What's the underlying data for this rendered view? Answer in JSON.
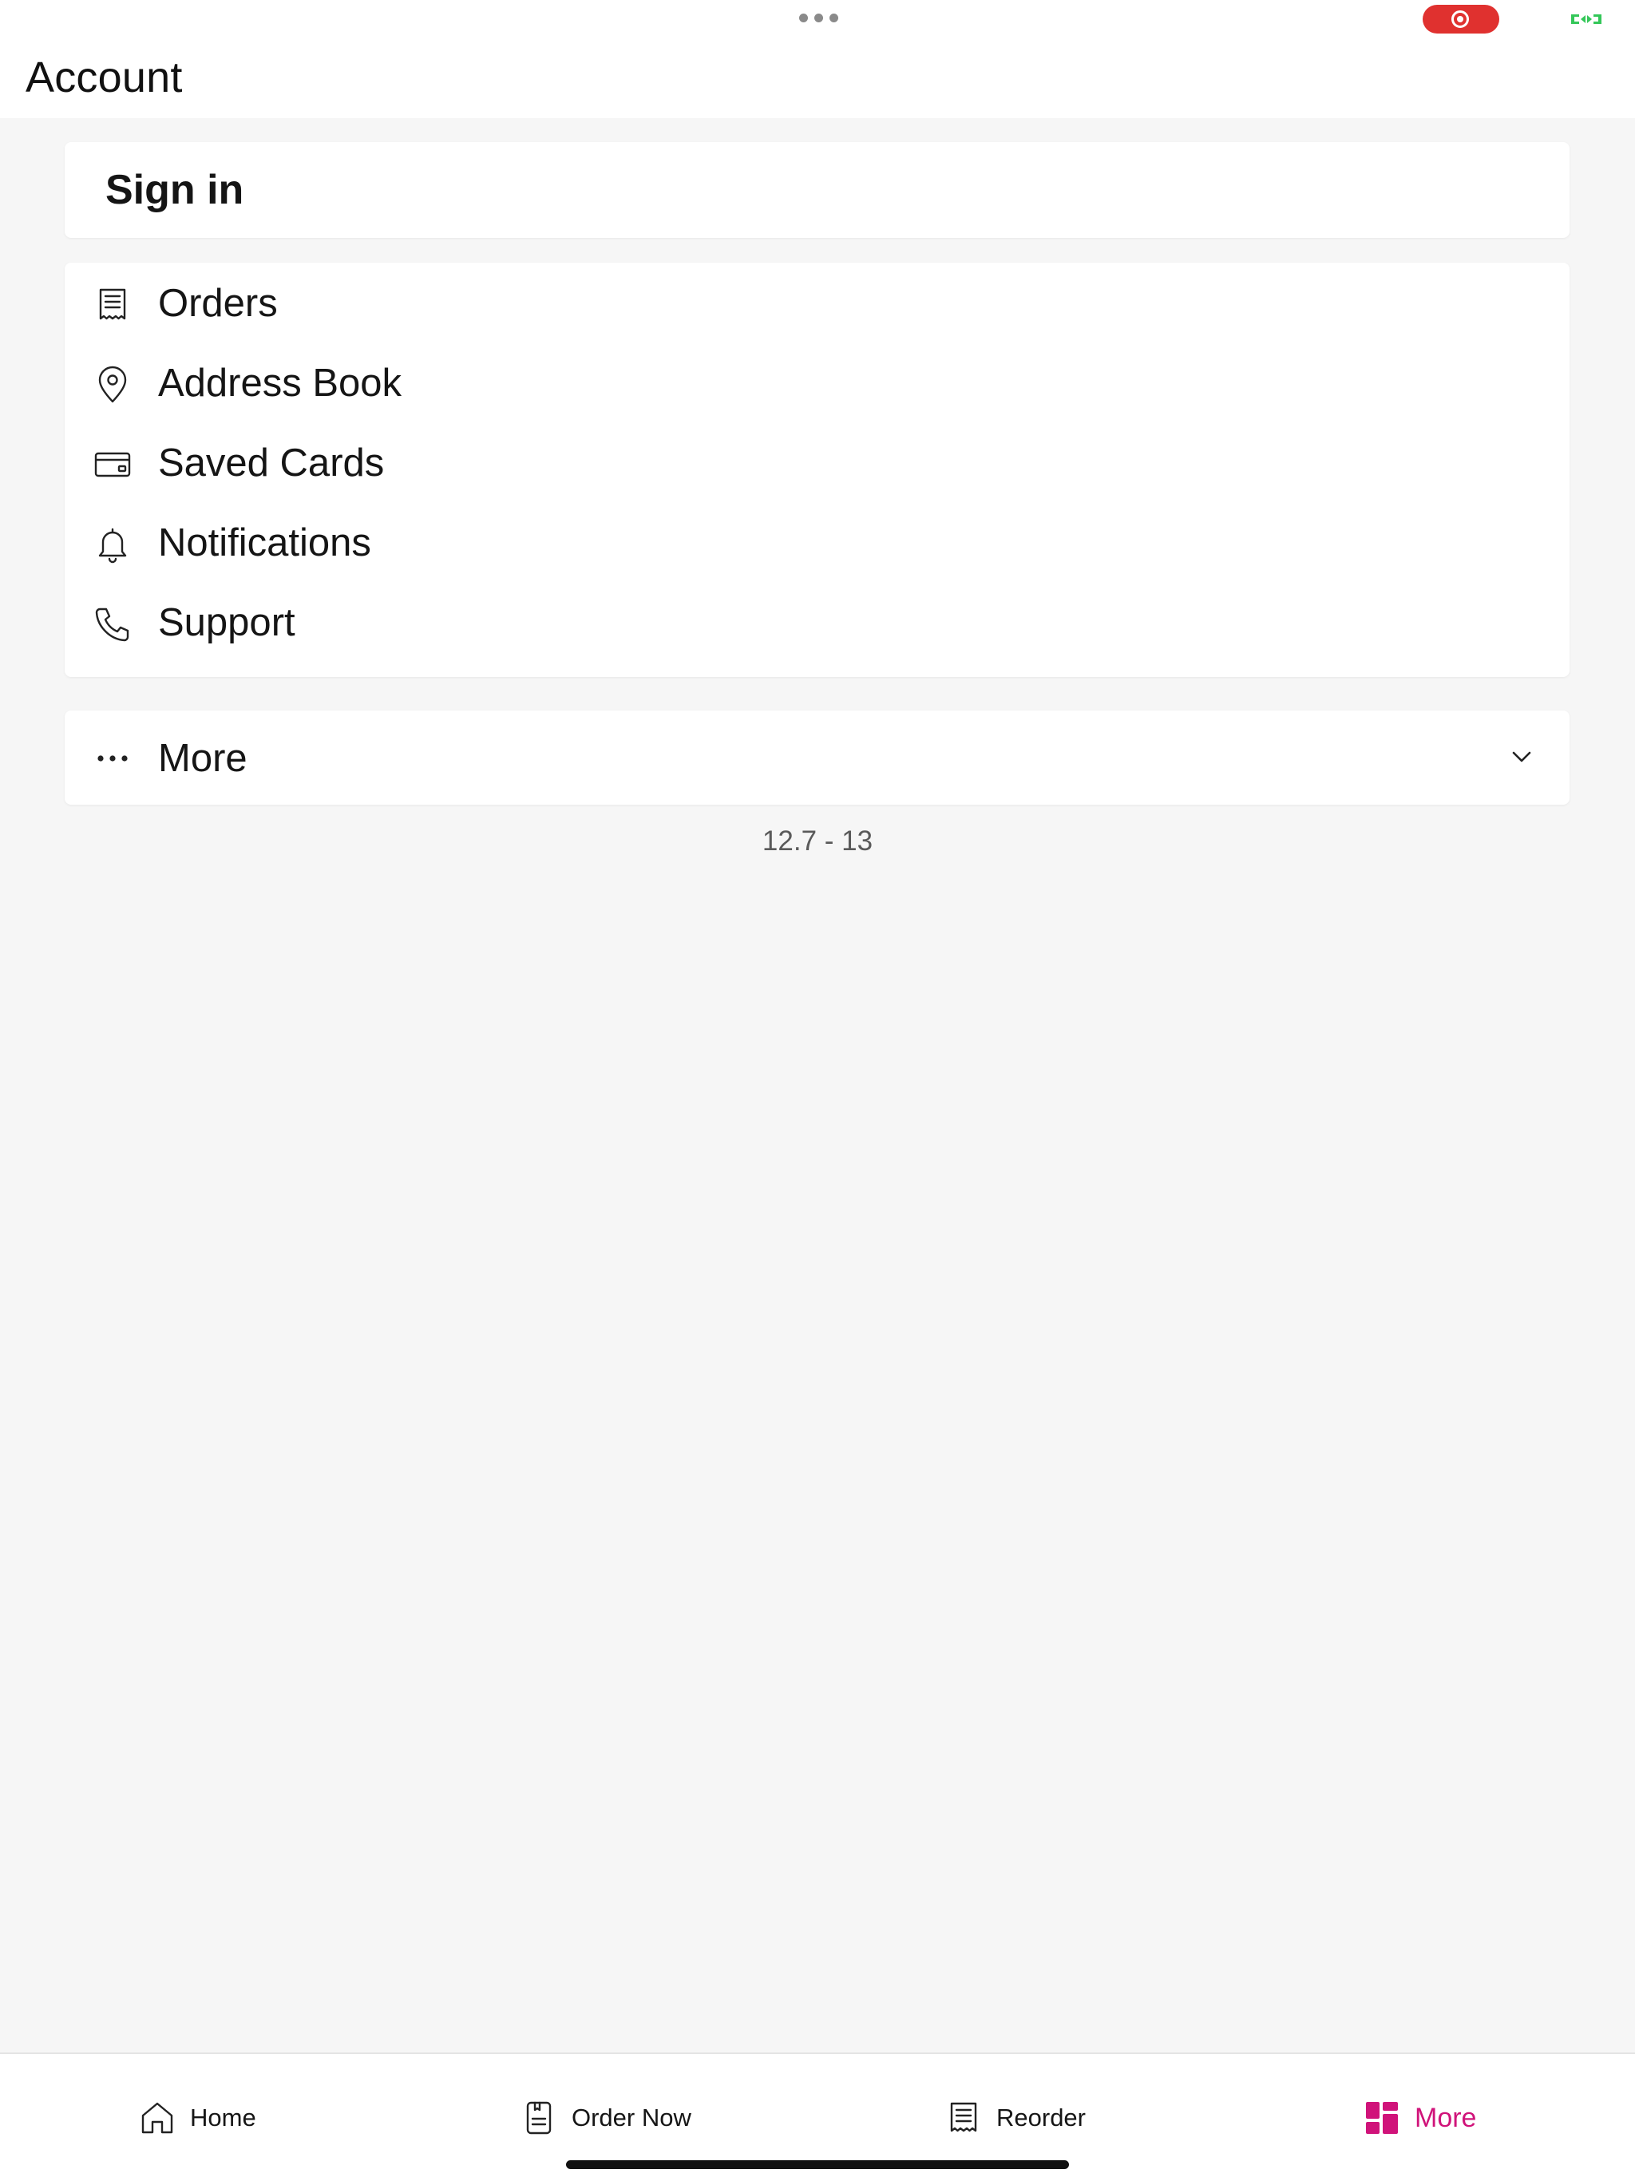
{
  "header": {
    "title": "Account"
  },
  "signin": {
    "label": "Sign in"
  },
  "menu": {
    "items": [
      {
        "label": "Orders",
        "icon": "receipt-icon"
      },
      {
        "label": "Address Book",
        "icon": "location-pin-icon"
      },
      {
        "label": "Saved Cards",
        "icon": "credit-card-icon"
      },
      {
        "label": "Notifications",
        "icon": "bell-icon"
      },
      {
        "label": "Support",
        "icon": "phone-icon"
      }
    ]
  },
  "more": {
    "label": "More",
    "icon": "ellipsis-icon",
    "expand_icon": "chevron-down-icon"
  },
  "version": "12.7 - 13",
  "tabbar": {
    "tabs": [
      {
        "label": "Home",
        "icon": "home-icon"
      },
      {
        "label": "Order Now",
        "icon": "order-document-icon"
      },
      {
        "label": "Reorder",
        "icon": "receipt-icon"
      },
      {
        "label": "More",
        "icon": "grid-icon",
        "active": true
      }
    ]
  },
  "colors": {
    "accent": "#d0137a",
    "background": "#f6f6f6",
    "recording": "#e0312f",
    "battery": "#34c759"
  }
}
